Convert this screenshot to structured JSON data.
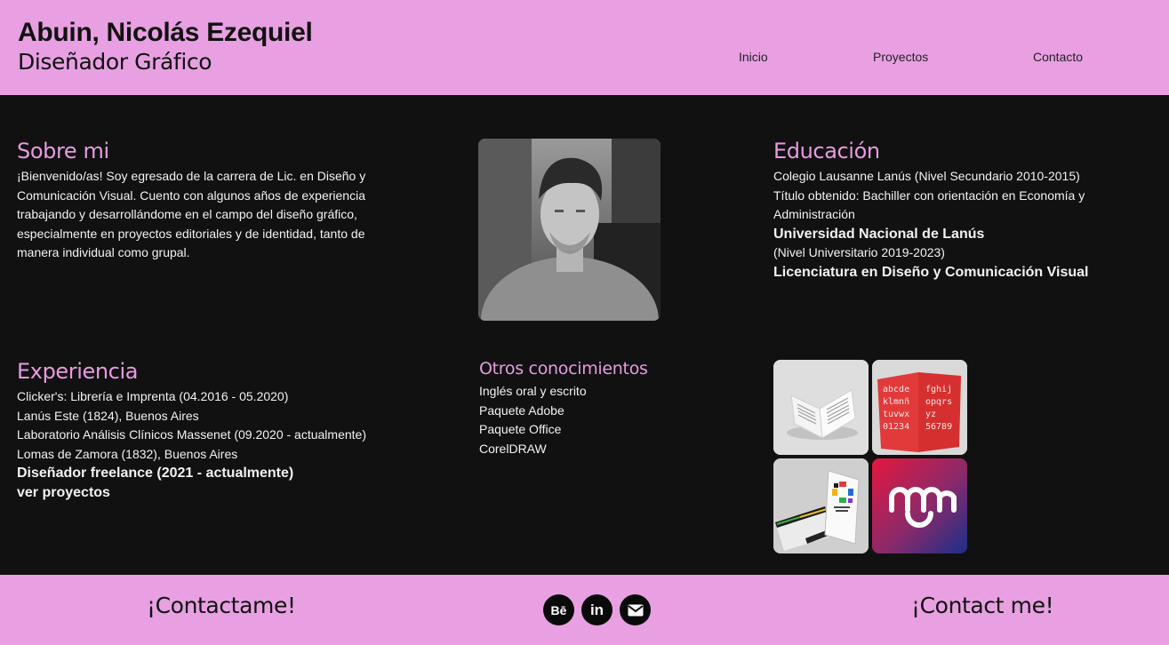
{
  "header": {
    "name": "Abuin, Nicolás Ezequiel",
    "role": "Diseñador Gráfico",
    "nav": [
      "Inicio",
      "Proyectos",
      "Contacto"
    ]
  },
  "about": {
    "title": "Sobre mi",
    "text": "¡Bienvenido/as! Soy egresado de la carrera de Lic. en Diseño y Comunicación Visual. Cuento con algunos años de experiencia trabajando y desarrollándome en el campo del diseño gráfico, especialmente en proyectos editoriales y de identidad, tanto de manera individual como grupal."
  },
  "education": {
    "title": "Educación",
    "line1": "Colegio Lausanne Lanús (Nivel Secundario 2010-2015)",
    "line2": "Título obtenido: Bachiller con orientación en Economía y Administración",
    "line3": "Universidad Nacional de Lanús",
    "line4": "(Nivel Universitario 2019-2023)",
    "line5": "Licenciatura en Diseño y Comunicación Visual"
  },
  "experience": {
    "title": "Experiencia",
    "line1": "Clicker's: Librería e Imprenta (04.2016 - 05.2020)",
    "line2": "Lanús Este (1824), Buenos Aires",
    "line3": "Laboratorio Análisis Clínicos Massenet (09.2020 - actualmente)",
    "line4": "Lomas de Zamora (1832), Buenos Aires",
    "line5": "Diseñador freelance (2021 - actualmente)",
    "link": "ver proyectos"
  },
  "skills": {
    "title": "Otros conocimientos",
    "items": [
      "Inglés oral y escrito",
      "Paquete Adobe",
      "Paquete Office",
      "CorelDRAW"
    ]
  },
  "type_specimen": {
    "row1": "abcde",
    "row1b": "fghij",
    "row2": "klmnñ",
    "row2b": "opqrs",
    "row3": "tuvwx",
    "row3b": "yz",
    "row4": "01234",
    "row4b": "56789"
  },
  "footer": {
    "contact_es": "¡Contactame!",
    "contact_en": "¡Contact me!",
    "behance": "Bē",
    "linkedin": "in"
  },
  "colors": {
    "accent": "#e8a0e2",
    "background": "#111111",
    "heading": "#e79be1"
  }
}
